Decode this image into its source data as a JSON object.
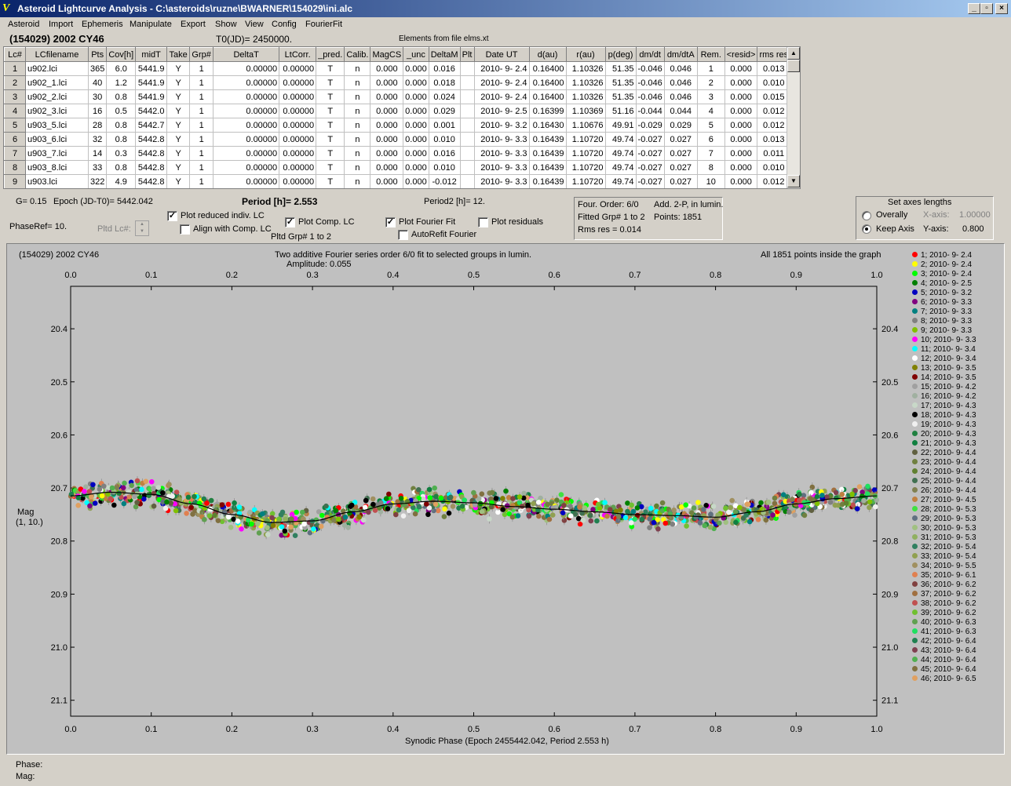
{
  "window": {
    "title": "Asteroid Lightcurve Analysis - C:\\asteroids\\ruzne\\BWARNER\\154029\\ini.alc",
    "app_icon": "V",
    "min_icon": "_",
    "max_icon": "▫",
    "close_icon": "×"
  },
  "menu": [
    "Asteroid",
    "Import",
    "Ephemeris",
    "Manipulate",
    "Export",
    "Show",
    "View",
    "Config",
    "FourierFit"
  ],
  "header": {
    "object": "(154029) 2002 CY46",
    "t0": "T0(JD)= 2450000.",
    "elements": "Elements from file elms.xt"
  },
  "table": {
    "columns": [
      "Lc#",
      "LCfilename",
      "Pts",
      "Cov[h]",
      "midT",
      "Take",
      "Grp#",
      "DeltaT",
      "LtCorr.",
      "_pred.",
      "Calib.",
      "MagCS",
      "_unc",
      "DeltaM",
      "Plt",
      "Date UT",
      "d(au)",
      "r(au)",
      "p(deg)",
      "dm/dt",
      "dm/dtA",
      "Rem.",
      "<resid>",
      "rms res"
    ],
    "rows": [
      [
        "1",
        "u902.lci",
        "365",
        "6.0",
        "5441.9",
        "Y",
        "1",
        "0.00000",
        "0.00000",
        "T",
        "n",
        "0.000",
        "0.000",
        "0.016",
        "",
        "2010- 9- 2.4",
        "0.16400",
        "1.10326",
        "51.35",
        "-0.046",
        "0.046",
        "1",
        "0.000",
        "0.013"
      ],
      [
        "2",
        "u902_1.lci",
        "40",
        "1.2",
        "5441.9",
        "Y",
        "1",
        "0.00000",
        "0.00000",
        "T",
        "n",
        "0.000",
        "0.000",
        "0.018",
        "",
        "2010- 9- 2.4",
        "0.16400",
        "1.10326",
        "51.35",
        "-0.046",
        "0.046",
        "2",
        "0.000",
        "0.010"
      ],
      [
        "3",
        "u902_2.lci",
        "30",
        "0.8",
        "5441.9",
        "Y",
        "1",
        "0.00000",
        "0.00000",
        "T",
        "n",
        "0.000",
        "0.000",
        "0.024",
        "",
        "2010- 9- 2.4",
        "0.16400",
        "1.10326",
        "51.35",
        "-0.046",
        "0.046",
        "3",
        "0.000",
        "0.015"
      ],
      [
        "4",
        "u902_3.lci",
        "16",
        "0.5",
        "5442.0",
        "Y",
        "1",
        "0.00000",
        "0.00000",
        "T",
        "n",
        "0.000",
        "0.000",
        "0.029",
        "",
        "2010- 9- 2.5",
        "0.16399",
        "1.10369",
        "51.16",
        "-0.044",
        "0.044",
        "4",
        "0.000",
        "0.012"
      ],
      [
        "5",
        "u903_5.lci",
        "28",
        "0.8",
        "5442.7",
        "Y",
        "1",
        "0.00000",
        "0.00000",
        "T",
        "n",
        "0.000",
        "0.000",
        "0.001",
        "",
        "2010- 9- 3.2",
        "0.16430",
        "1.10676",
        "49.91",
        "-0.029",
        "0.029",
        "5",
        "0.000",
        "0.012"
      ],
      [
        "6",
        "u903_6.lci",
        "32",
        "0.8",
        "5442.8",
        "Y",
        "1",
        "0.00000",
        "0.00000",
        "T",
        "n",
        "0.000",
        "0.000",
        "0.010",
        "",
        "2010- 9- 3.3",
        "0.16439",
        "1.10720",
        "49.74",
        "-0.027",
        "0.027",
        "6",
        "0.000",
        "0.013"
      ],
      [
        "7",
        "u903_7.lci",
        "14",
        "0.3",
        "5442.8",
        "Y",
        "1",
        "0.00000",
        "0.00000",
        "T",
        "n",
        "0.000",
        "0.000",
        "0.016",
        "",
        "2010- 9- 3.3",
        "0.16439",
        "1.10720",
        "49.74",
        "-0.027",
        "0.027",
        "7",
        "0.000",
        "0.011"
      ],
      [
        "8",
        "u903_8.lci",
        "33",
        "0.8",
        "5442.8",
        "Y",
        "1",
        "0.00000",
        "0.00000",
        "T",
        "n",
        "0.000",
        "0.000",
        "0.010",
        "",
        "2010- 9- 3.3",
        "0.16439",
        "1.10720",
        "49.74",
        "-0.027",
        "0.027",
        "8",
        "0.000",
        "0.010"
      ],
      [
        "9",
        "u903.lci",
        "322",
        "4.9",
        "5442.8",
        "Y",
        "1",
        "0.00000",
        "0.00000",
        "T",
        "n",
        "0.000",
        "0.000",
        "-0.012",
        "",
        "2010- 9- 3.3",
        "0.16439",
        "1.10720",
        "49.74",
        "-0.027",
        "0.027",
        "10",
        "0.000",
        "0.012"
      ]
    ],
    "scroll_up_icon": "▲",
    "scroll_down_icon": "▼"
  },
  "controls": {
    "g_value": "G= 0.15",
    "epoch": "Epoch (JD-T0)= 5442.042",
    "period": "Period [h]= 2.553",
    "period2": "Period2 [h]= 12.",
    "phase_ref": "PhaseRef= 10.",
    "pltd_lc": "Pltd Lc#:",
    "plot_reduced": {
      "label": "Plot reduced indiv. LC",
      "checked": true
    },
    "align_comp": {
      "label": "Align with Comp. LC",
      "checked": false
    },
    "plot_comp": {
      "label": "Plot Comp. LC",
      "checked": true
    },
    "pltd_grp": "Pltd Grp#  1   to    2",
    "plot_fourier": {
      "label": "Plot Fourier Fit",
      "checked": true
    },
    "autorefit": {
      "label": "AutoRefit Fourier",
      "checked": false
    },
    "plot_residuals": {
      "label": "Plot residuals",
      "checked": false
    },
    "check_mark": "✓"
  },
  "fit_info": {
    "order": "Four. Order:  6/0",
    "add": "Add. 2-P, in lumin.",
    "fitted": "Fitted Grp# 1 to 2",
    "points": "Points: 1851",
    "rms": "Rms res     = 0.014"
  },
  "axes": {
    "title": "Set axes lengths",
    "overally": "Overally",
    "keep_axis": "Keep Axis",
    "x_label": "X-axis:",
    "x_value": "1.00000",
    "y_label": "Y-axis:",
    "y_value": "0.800",
    "selected": "keep"
  },
  "chart_data": {
    "type": "scatter",
    "title_left": "(154029) 2002 CY46",
    "title_center": "Two additive Fourier series order 6/0 fit to selected groups in lumin.",
    "amplitude": "Amplitude: 0.055",
    "title_right": "All 1851 points inside the graph",
    "xlabel": "Synodic Phase (Epoch 2455442.042, Period 2.553 h)",
    "ylabel": "Mag",
    "ylabel2": "(1, 10.)",
    "xlim": [
      0.0,
      1.0
    ],
    "ylim": [
      20.32,
      21.13
    ],
    "x_ticks": [
      "0.0",
      "0.1",
      "0.2",
      "0.3",
      "0.4",
      "0.5",
      "0.6",
      "0.7",
      "0.8",
      "0.9",
      "1.0"
    ],
    "y_ticks": [
      "20.4",
      "20.5",
      "20.6",
      "20.7",
      "20.8",
      "20.9",
      "21.0",
      "21.1"
    ],
    "y_tick_values": [
      20.4,
      20.5,
      20.6,
      20.7,
      20.8,
      20.9,
      21.0,
      21.1
    ],
    "fit_curve": {
      "x": [
        0.0,
        0.05,
        0.1,
        0.15,
        0.2,
        0.25,
        0.3,
        0.35,
        0.4,
        0.45,
        0.5,
        0.55,
        0.6,
        0.65,
        0.7,
        0.75,
        0.8,
        0.85,
        0.9,
        0.95,
        1.0
      ],
      "y": [
        20.715,
        20.708,
        20.712,
        20.73,
        20.75,
        20.765,
        20.762,
        20.745,
        20.73,
        20.725,
        20.728,
        20.735,
        20.74,
        20.745,
        20.75,
        20.752,
        20.755,
        20.745,
        20.73,
        20.72,
        20.715
      ]
    }
  },
  "legend": [
    {
      "label": "1; 2010- 9- 2.4",
      "color": "#ff0000"
    },
    {
      "label": "2; 2010- 9- 2.4",
      "color": "#ffff00"
    },
    {
      "label": "3; 2010- 9- 2.4",
      "color": "#00ff00"
    },
    {
      "label": "4; 2010- 9- 2.5",
      "color": "#008000"
    },
    {
      "label": "5; 2010- 9- 3.2",
      "color": "#0000c0"
    },
    {
      "label": "6; 2010- 9- 3.3",
      "color": "#800080"
    },
    {
      "label": "7; 2010- 9- 3.3",
      "color": "#008080"
    },
    {
      "label": "8; 2010- 9- 3.3",
      "color": "#808080"
    },
    {
      "label": "9; 2010- 9- 3.3",
      "color": "#80c000"
    },
    {
      "label": "10; 2010- 9- 3.3",
      "color": "#ff00ff"
    },
    {
      "label": "11; 2010- 9- 3.4",
      "color": "#00ffff"
    },
    {
      "label": "12; 2010- 9- 3.4",
      "color": "#ffffff"
    },
    {
      "label": "13; 2010- 9- 3.5",
      "color": "#808000"
    },
    {
      "label": "14; 2010- 9- 3.5",
      "color": "#800000"
    },
    {
      "label": "15; 2010- 9- 4.2",
      "color": "#a0a0a0"
    },
    {
      "label": "16; 2010- 9- 4.2",
      "color": "#a0b0a0"
    },
    {
      "label": "17; 2010- 9- 4.3",
      "color": "#c8d8c8"
    },
    {
      "label": "18; 2010- 9- 4.3",
      "color": "#000000"
    },
    {
      "label": "19; 2010- 9- 4.3",
      "color": "#f0f0f0"
    },
    {
      "label": "20; 2010- 9- 4.3",
      "color": "#208040"
    },
    {
      "label": "21; 2010- 9- 4.3",
      "color": "#108040"
    },
    {
      "label": "22; 2010- 9- 4.4",
      "color": "#606040"
    },
    {
      "label": "23; 2010- 9- 4.4",
      "color": "#708040"
    },
    {
      "label": "24; 2010- 9- 4.4",
      "color": "#608030"
    },
    {
      "label": "25; 2010- 9- 4.4",
      "color": "#407050"
    },
    {
      "label": "26; 2010- 9- 4.4",
      "color": "#808050"
    },
    {
      "label": "27; 2010- 9- 4.5",
      "color": "#c08040"
    },
    {
      "label": "28; 2010- 9- 5.3",
      "color": "#40e040"
    },
    {
      "label": "29; 2010- 9- 5.3",
      "color": "#607080"
    },
    {
      "label": "30; 2010- 9- 5.3",
      "color": "#a0c080"
    },
    {
      "label": "31; 2010- 9- 5.3",
      "color": "#90b060"
    },
    {
      "label": "32; 2010- 9- 5.4",
      "color": "#308060"
    },
    {
      "label": "33; 2010- 9- 5.4",
      "color": "#90a050"
    },
    {
      "label": "34; 2010- 9- 5.5",
      "color": "#a09060"
    },
    {
      "label": "35; 2010- 9- 6.1",
      "color": "#e08050"
    },
    {
      "label": "36; 2010- 9- 6.2",
      "color": "#804040"
    },
    {
      "label": "37; 2010- 9- 6.2",
      "color": "#a07040"
    },
    {
      "label": "38; 2010- 9- 6.2",
      "color": "#c05050"
    },
    {
      "label": "39; 2010- 9- 6.2",
      "color": "#70c030"
    },
    {
      "label": "40; 2010- 9- 6.3",
      "color": "#60a050"
    },
    {
      "label": "41; 2010- 9- 6.3",
      "color": "#20e060"
    },
    {
      "label": "42; 2010- 9- 6.4",
      "color": "#208050"
    },
    {
      "label": "43; 2010- 9- 6.4",
      "color": "#804050"
    },
    {
      "label": "44; 2010- 9- 6.4",
      "color": "#50b050"
    },
    {
      "label": "45; 2010- 9- 6.4",
      "color": "#807040"
    },
    {
      "label": "46; 2010- 9- 6.5",
      "color": "#e0a060"
    }
  ],
  "status": {
    "phase": "Phase:",
    "mag": "Mag:"
  }
}
